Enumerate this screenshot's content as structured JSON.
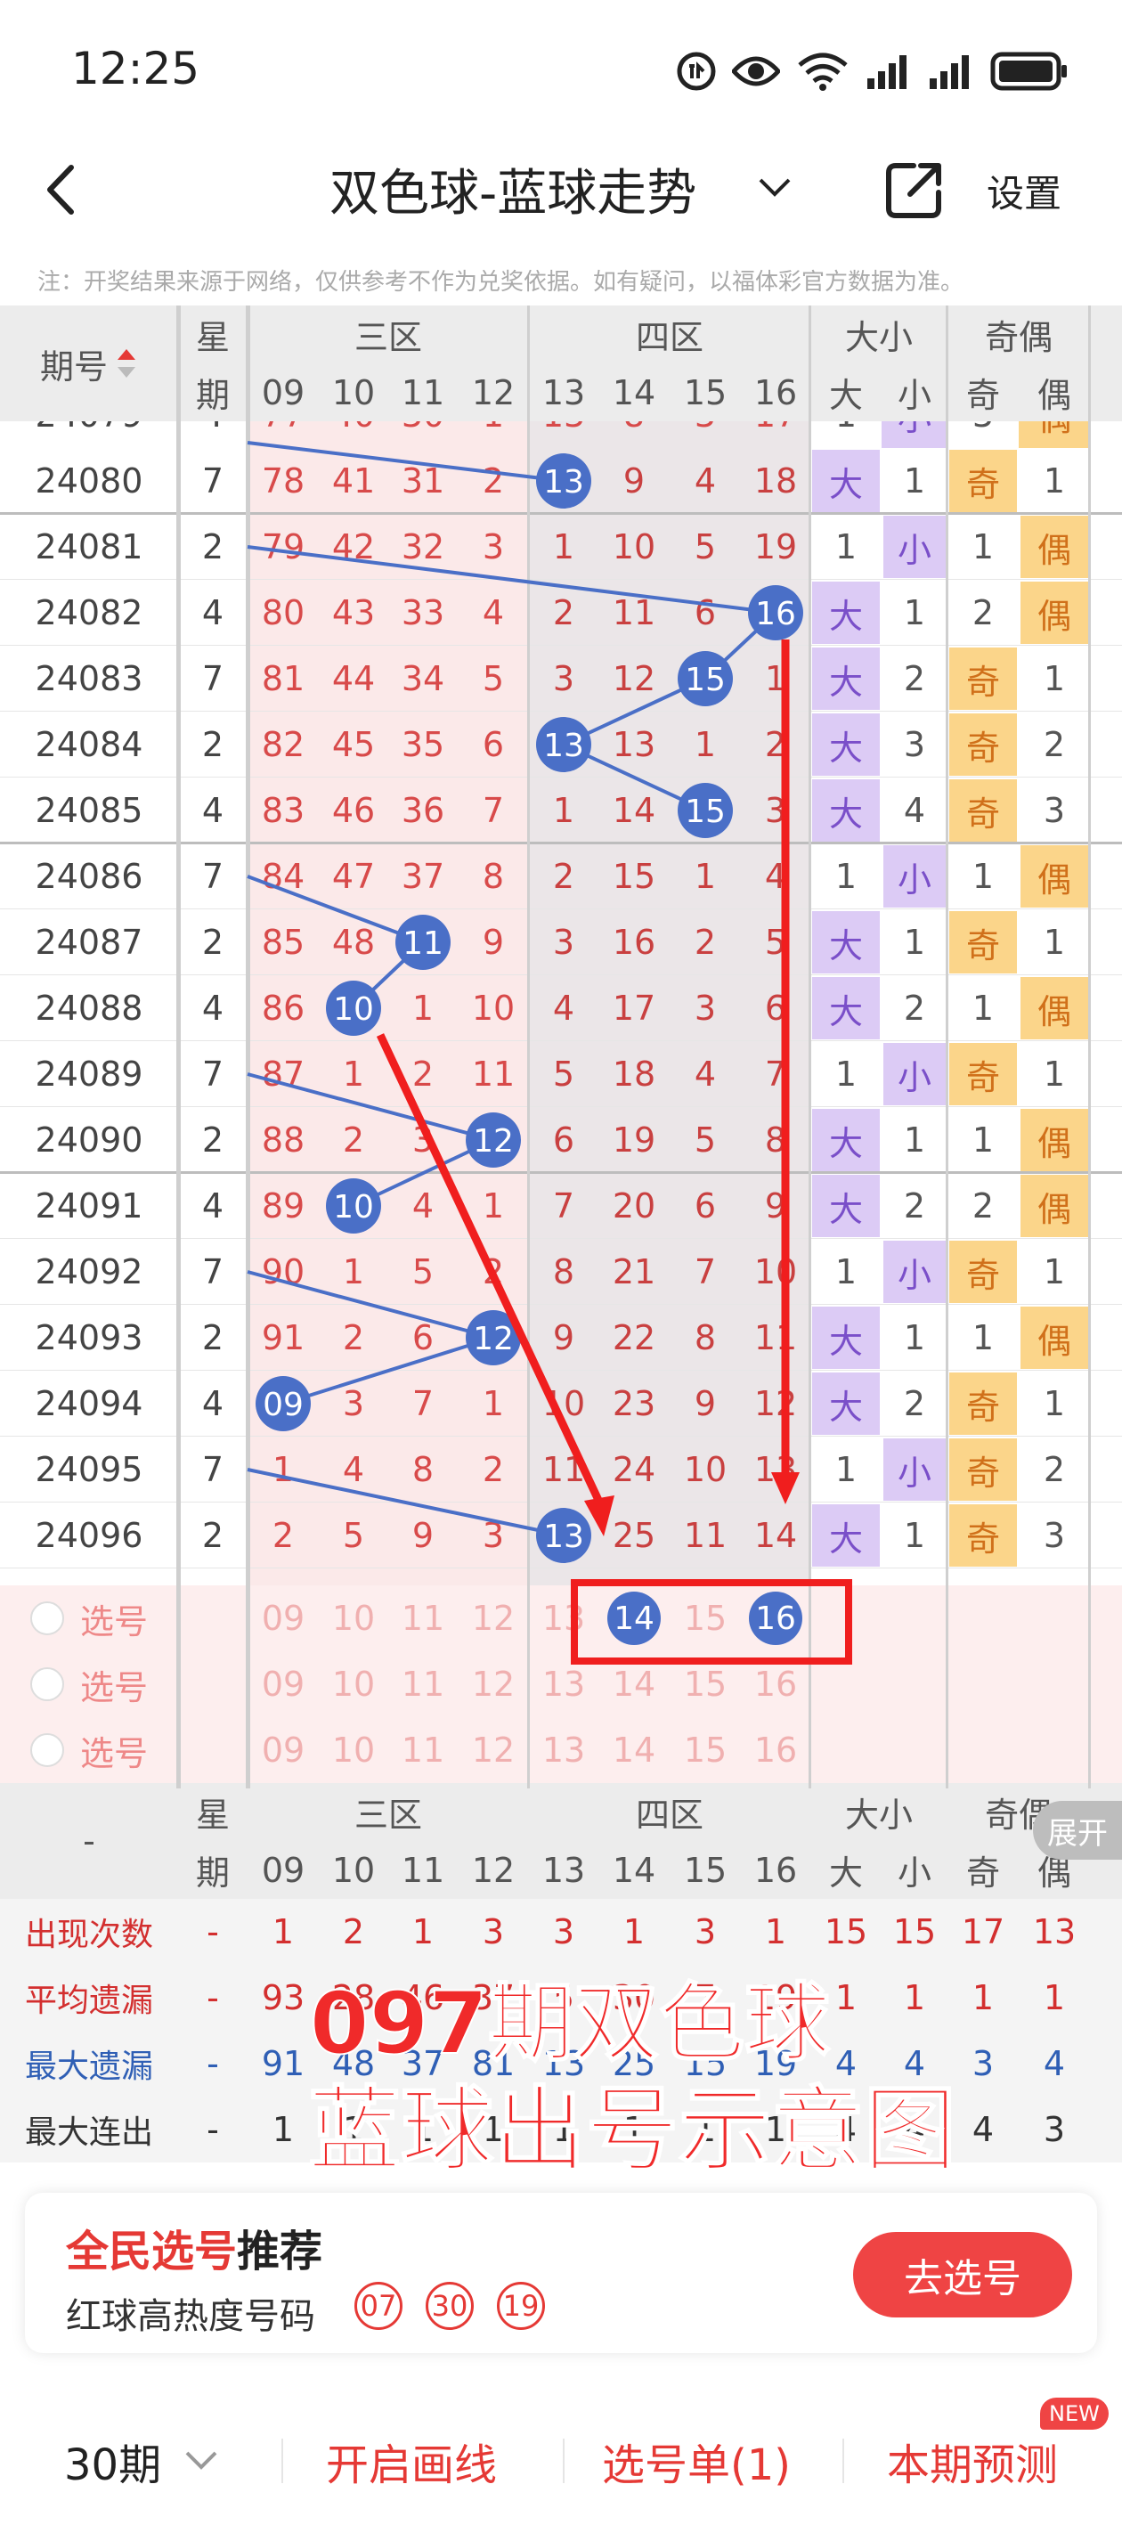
{
  "status": {
    "time": "12:25"
  },
  "header": {
    "title": "双色球-蓝球走势",
    "settings": "设置"
  },
  "note": "注：开奖结果来源于网络，仅供参考不作为兑奖依据。如有疑问，以福体彩官方数据为准。",
  "table": {
    "issue_header": "期号",
    "weekday_header_1": "星",
    "weekday_header_2": "期",
    "group_labels": [
      "三区",
      "四区",
      "大小",
      "奇偶"
    ],
    "number_headers": [
      "09",
      "10",
      "11",
      "12",
      "13",
      "14",
      "15",
      "16"
    ],
    "bs_headers": [
      "大",
      "小"
    ],
    "oe_headers": [
      "奇",
      "偶"
    ],
    "partial_top_row": {
      "issue": "24079",
      "weekday": "4",
      "nums": [
        "77",
        "40",
        "30",
        "1",
        "13",
        "8",
        "3",
        "17"
      ],
      "bs": [
        "1",
        "小"
      ],
      "oe": [
        "3",
        "偶"
      ]
    },
    "rows": [
      {
        "issue": "24080",
        "weekday": "7",
        "nums": [
          "78",
          "41",
          "31",
          "2",
          "13",
          "9",
          "4",
          "18"
        ],
        "bs": [
          "大",
          "1"
        ],
        "oe": [
          "奇",
          "1"
        ],
        "ball": "13",
        "ball_index": 4
      },
      {
        "issue": "24081",
        "weekday": "2",
        "nums": [
          "79",
          "42",
          "32",
          "3",
          "1",
          "10",
          "5",
          "19"
        ],
        "bs": [
          "1",
          "小"
        ],
        "oe": [
          "1",
          "偶"
        ],
        "ball": null,
        "ball_index": -1
      },
      {
        "issue": "24082",
        "weekday": "4",
        "nums": [
          "80",
          "43",
          "33",
          "4",
          "2",
          "11",
          "6",
          "16"
        ],
        "bs": [
          "大",
          "1"
        ],
        "oe": [
          "2",
          "偶"
        ],
        "ball": "16",
        "ball_index": 7
      },
      {
        "issue": "24083",
        "weekday": "7",
        "nums": [
          "81",
          "44",
          "34",
          "5",
          "3",
          "12",
          "15",
          "1"
        ],
        "bs": [
          "大",
          "2"
        ],
        "oe": [
          "奇",
          "1"
        ],
        "ball": "15",
        "ball_index": 6
      },
      {
        "issue": "24084",
        "weekday": "2",
        "nums": [
          "82",
          "45",
          "35",
          "6",
          "13",
          "13",
          "1",
          "2"
        ],
        "bs": [
          "大",
          "3"
        ],
        "oe": [
          "奇",
          "2"
        ],
        "ball": "13",
        "ball_index": 4
      },
      {
        "issue": "24085",
        "weekday": "4",
        "nums": [
          "83",
          "46",
          "36",
          "7",
          "1",
          "14",
          "15",
          "3"
        ],
        "bs": [
          "大",
          "4"
        ],
        "oe": [
          "奇",
          "3"
        ],
        "ball": "15",
        "ball_index": 6
      },
      {
        "issue": "24086",
        "weekday": "7",
        "nums": [
          "84",
          "47",
          "37",
          "8",
          "2",
          "15",
          "1",
          "4"
        ],
        "bs": [
          "1",
          "小"
        ],
        "oe": [
          "1",
          "偶"
        ],
        "ball": null,
        "ball_index": -1
      },
      {
        "issue": "24087",
        "weekday": "2",
        "nums": [
          "85",
          "48",
          "11",
          "9",
          "3",
          "16",
          "2",
          "5"
        ],
        "bs": [
          "大",
          "1"
        ],
        "oe": [
          "奇",
          "1"
        ],
        "ball": "11",
        "ball_index": 2
      },
      {
        "issue": "24088",
        "weekday": "4",
        "nums": [
          "86",
          "10",
          "1",
          "10",
          "4",
          "17",
          "3",
          "6"
        ],
        "bs": [
          "大",
          "2"
        ],
        "oe": [
          "1",
          "偶"
        ],
        "ball": "10",
        "ball_index": 1
      },
      {
        "issue": "24089",
        "weekday": "7",
        "nums": [
          "87",
          "1",
          "2",
          "11",
          "5",
          "18",
          "4",
          "7"
        ],
        "bs": [
          "1",
          "小"
        ],
        "oe": [
          "奇",
          "1"
        ],
        "ball": null,
        "ball_index": -1
      },
      {
        "issue": "24090",
        "weekday": "2",
        "nums": [
          "88",
          "2",
          "3",
          "12",
          "6",
          "19",
          "5",
          "8"
        ],
        "bs": [
          "大",
          "1"
        ],
        "oe": [
          "1",
          "偶"
        ],
        "ball": "12",
        "ball_index": 3
      },
      {
        "issue": "24091",
        "weekday": "4",
        "nums": [
          "89",
          "10",
          "4",
          "1",
          "7",
          "20",
          "6",
          "9"
        ],
        "bs": [
          "大",
          "2"
        ],
        "oe": [
          "2",
          "偶"
        ],
        "ball": "10",
        "ball_index": 1
      },
      {
        "issue": "24092",
        "weekday": "7",
        "nums": [
          "90",
          "1",
          "5",
          "2",
          "8",
          "21",
          "7",
          "10"
        ],
        "bs": [
          "1",
          "小"
        ],
        "oe": [
          "奇",
          "1"
        ],
        "ball": null,
        "ball_index": -1
      },
      {
        "issue": "24093",
        "weekday": "2",
        "nums": [
          "91",
          "2",
          "6",
          "12",
          "9",
          "22",
          "8",
          "11"
        ],
        "bs": [
          "大",
          "1"
        ],
        "oe": [
          "1",
          "偶"
        ],
        "ball": "12",
        "ball_index": 3
      },
      {
        "issue": "24094",
        "weekday": "4",
        "nums": [
          "09",
          "3",
          "7",
          "1",
          "10",
          "23",
          "9",
          "12"
        ],
        "bs": [
          "大",
          "2"
        ],
        "oe": [
          "奇",
          "1"
        ],
        "ball": "09",
        "ball_index": 0
      },
      {
        "issue": "24095",
        "weekday": "7",
        "nums": [
          "1",
          "4",
          "8",
          "2",
          "11",
          "24",
          "10",
          "13"
        ],
        "bs": [
          "1",
          "小"
        ],
        "oe": [
          "奇",
          "2"
        ],
        "ball": null,
        "ball_index": -1
      },
      {
        "issue": "24096",
        "weekday": "2",
        "nums": [
          "2",
          "5",
          "9",
          "3",
          "13",
          "25",
          "11",
          "14"
        ],
        "bs": [
          "大",
          "1"
        ],
        "oe": [
          "奇",
          "3"
        ],
        "ball": "13",
        "ball_index": 4
      }
    ],
    "pick_label": "选号",
    "pick_rows": [
      {
        "selected": [
          5,
          7
        ]
      },
      {
        "selected": []
      },
      {
        "selected": []
      }
    ],
    "stat_dash": "-",
    "stat_rows": [
      {
        "label": "出现次数",
        "weekday": "-",
        "nums": [
          "1",
          "2",
          "1",
          "3",
          "3",
          "1",
          "3",
          "1"
        ],
        "bs": [
          "15",
          "15"
        ],
        "oe": [
          "17",
          "13"
        ],
        "color": "#d32f2f"
      },
      {
        "label": "平均遗漏",
        "weekday": "-",
        "nums": [
          "93",
          "28",
          "46",
          "37",
          "5",
          "30",
          "7",
          "19"
        ],
        "bs": [
          "1",
          "1"
        ],
        "oe": [
          "1",
          "1"
        ],
        "color": "#d32f2f"
      },
      {
        "label": "最大遗漏",
        "weekday": "-",
        "nums": [
          "91",
          "48",
          "37",
          "81",
          "13",
          "25",
          "15",
          "19"
        ],
        "bs": [
          "4",
          "4"
        ],
        "oe": [
          "3",
          "4"
        ],
        "color": "#2f5fb5"
      },
      {
        "label": "最大连出",
        "weekday": "-",
        "nums": [
          "1",
          "1",
          "1",
          "1",
          "1",
          "1",
          "1",
          "1"
        ],
        "bs": [
          "4",
          "4"
        ],
        "oe": [
          "4",
          "3"
        ],
        "color": "#333333"
      }
    ],
    "expand_label": "展开"
  },
  "overlay": {
    "line1": "097期双色球",
    "line2": "蓝球出号示意图"
  },
  "recommend": {
    "title_red": "全民选号",
    "title_black": "推荐",
    "subtitle": "红球高热度号码",
    "balls": [
      "07",
      "30",
      "19"
    ],
    "button": "去选号"
  },
  "bottom": {
    "period": "30期",
    "draw_line": "开启画线",
    "pick_list": "选号单(1)",
    "forecast": "本期预测",
    "new_badge": "NEW"
  },
  "colors": {
    "red": "#e53935",
    "blue_ball": "#4a6fc7",
    "purple": "#dccbf5",
    "yellow": "#fbd58a",
    "zone_pink": "#fbe9e9",
    "zone_gray": "#ebe6e8"
  }
}
